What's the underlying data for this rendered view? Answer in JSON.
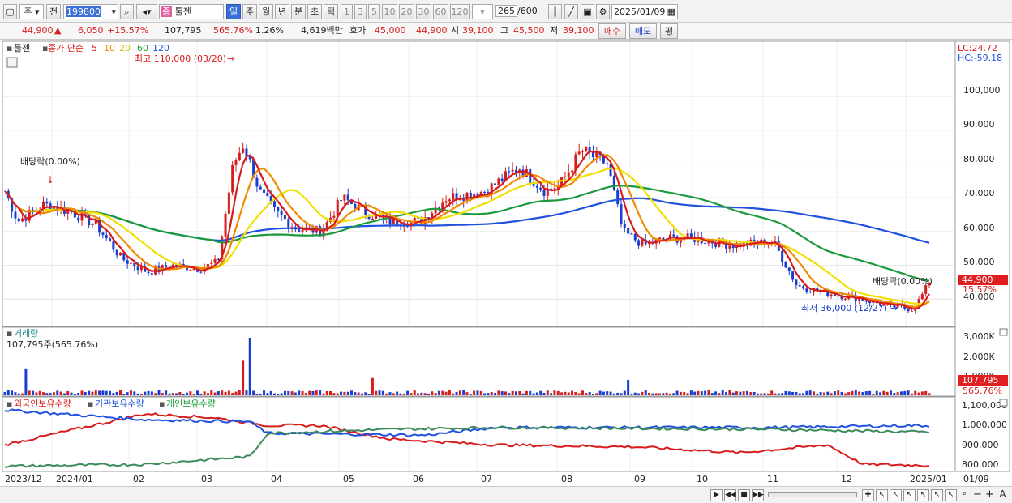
{
  "toolbar": {
    "market": "주",
    "prev_label": "전",
    "code": "199800",
    "stock_name": "툴젠",
    "stock_prefix": "종",
    "periods": [
      "일",
      "주",
      "월",
      "년",
      "분",
      "초",
      "틱"
    ],
    "active_period": "일",
    "intervals": [
      "1",
      "3",
      "5",
      "10",
      "20",
      "30",
      "60",
      "120"
    ],
    "count": "265",
    "count_total": "/600",
    "date": "2025/01/09"
  },
  "quote": {
    "price": "44,900",
    "arrow": "▲",
    "change": "6,050",
    "change_pct": "+15.57%",
    "volume": "107,795",
    "volume_pct": "565.76%",
    "turnover": "1.26%",
    "amount": "4,619백만",
    "ask_label": "호가",
    "ask1": "45,000",
    "ask2": "44,900",
    "open_label": "시",
    "open": "39,100",
    "high_label": "고",
    "high": "45,500",
    "low_label": "저",
    "low": "39,100",
    "buy_label": "매수",
    "sell_label": "매도",
    "eval_label": "평"
  },
  "price_panel": {
    "title": "툴젠",
    "ma_label": "종가 단순",
    "ma_periods": [
      "5",
      "10",
      "20",
      "60",
      "120"
    ],
    "ma_colors": [
      "#d81c1c",
      "#f08a00",
      "#f0e000",
      "#1a9a3a",
      "#2050e0"
    ],
    "lc": "LC:24.72",
    "hc": "HC:-59.18",
    "max_note": "최고 110,000 (03/20)",
    "min_note": "최저 36,000 (12/27)",
    "dividend_left": "배당락(0.00%)",
    "dividend_right": "배당락(0.00%)",
    "y_ticks": [
      "100,000",
      "90,000",
      "80,000",
      "70,000",
      "60,000",
      "50,000",
      "40,000"
    ],
    "current_price": "44,900",
    "current_pct": "15.57%"
  },
  "volume_panel": {
    "title": "거래량",
    "current_label": "107,795주(565.76%)",
    "y_ticks": [
      "3,000K",
      "2,000K",
      "1,000K"
    ],
    "current_value": "107,795",
    "current_pct": "565.76%"
  },
  "holding_panel": {
    "labels": [
      "외국인보유수량",
      "기관보유수량",
      "개인보유수량"
    ],
    "colors": [
      "#d81c1c",
      "#2050e0",
      "#1a9a3a"
    ],
    "y_ticks": [
      "1,100,000",
      "1,000,000",
      "900,000",
      "800,000"
    ]
  },
  "x_axis": [
    "2023/12",
    "2024/01",
    "02",
    "03",
    "04",
    "05",
    "06",
    "07",
    "08",
    "09",
    "10",
    "11",
    "12",
    "2025/01",
    "01/09"
  ],
  "chart_data": {
    "type": "line",
    "title": "툴젠",
    "series": [
      {
        "name": "툴젠",
        "values": [
          72000,
          62000,
          68000,
          66000,
          52000,
          48000,
          50000,
          49000,
          85000,
          72000,
          60000,
          58000,
          70000,
          64000,
          62000,
          63000,
          70000,
          72000,
          80000,
          68000,
          84000,
          78000,
          56000,
          58000,
          57000,
          58000,
          44000,
          42000,
          40000,
          37000,
          44900
        ]
      },
      {
        "name": "5",
        "values": []
      },
      {
        "name": "10",
        "values": []
      },
      {
        "name": "20",
        "values": []
      },
      {
        "name": "60",
        "values": []
      },
      {
        "name": "120",
        "values": []
      }
    ],
    "ylim": [
      36000,
      110000
    ]
  }
}
